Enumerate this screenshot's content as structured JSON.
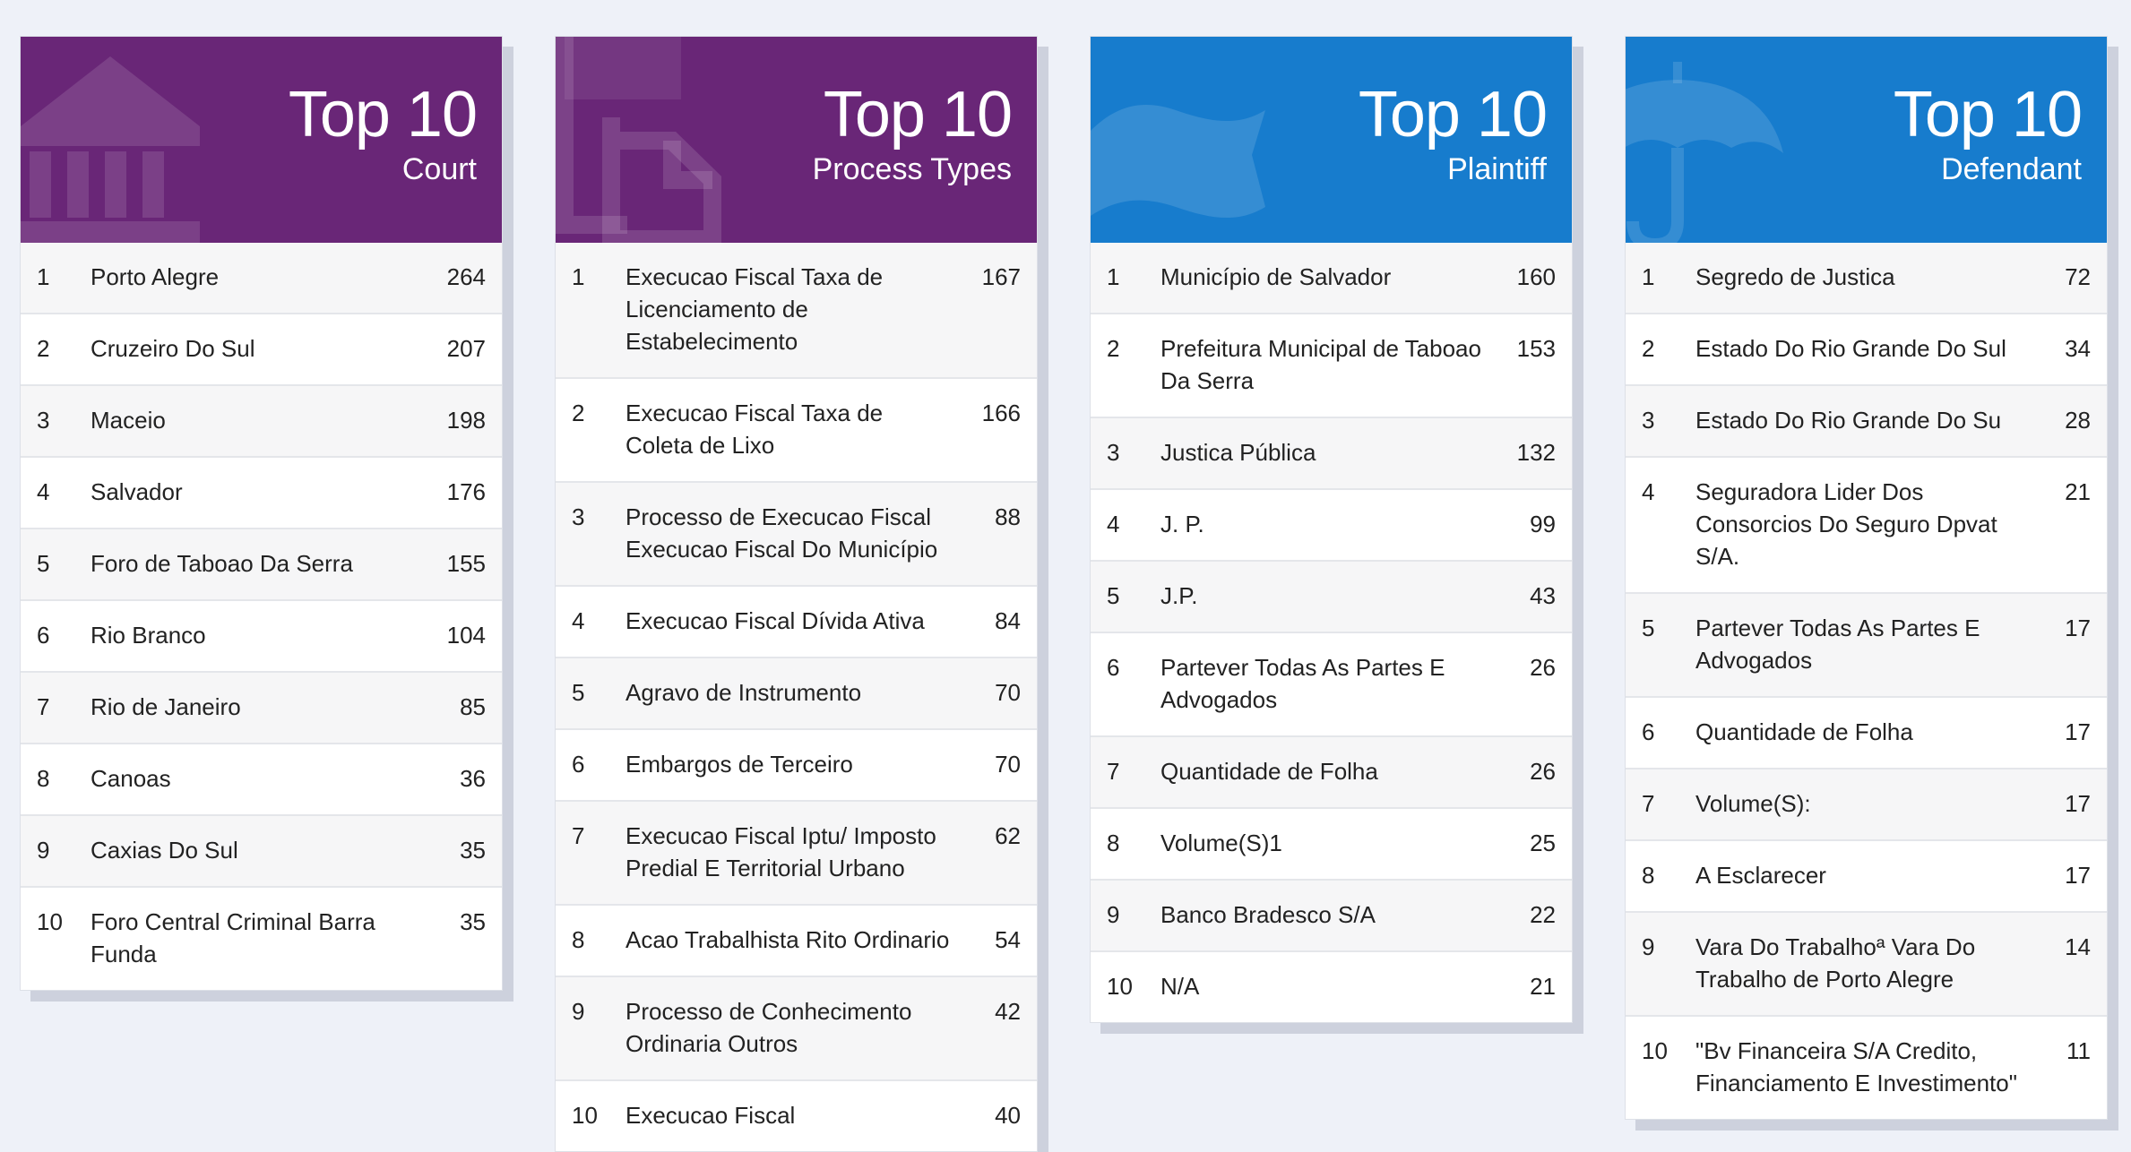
{
  "colors": {
    "purple": "#692677",
    "blue": "#177ccd",
    "background": "#eef1f8"
  },
  "cards": [
    {
      "title": "Top 10",
      "subtitle": "Court",
      "icon": "courthouse-icon",
      "rows": [
        {
          "rank": "1",
          "name": "Porto Alegre",
          "count": "264"
        },
        {
          "rank": "2",
          "name": "Cruzeiro Do Sul",
          "count": "207"
        },
        {
          "rank": "3",
          "name": "Maceio",
          "count": "198"
        },
        {
          "rank": "4",
          "name": "Salvador",
          "count": "176"
        },
        {
          "rank": "5",
          "name": "Foro de Taboao Da Serra",
          "count": "155"
        },
        {
          "rank": "6",
          "name": "Rio Branco",
          "count": "104"
        },
        {
          "rank": "7",
          "name": "Rio de Janeiro",
          "count": "85"
        },
        {
          "rank": "8",
          "name": "Canoas",
          "count": "36"
        },
        {
          "rank": "9",
          "name": "Caxias Do Sul",
          "count": "35"
        },
        {
          "rank": "10",
          "name": "Foro Central Criminal Barra Funda",
          "count": "35"
        }
      ]
    },
    {
      "title": "Top 10",
      "subtitle": "Process Types",
      "icon": "documents-icon",
      "rows": [
        {
          "rank": "1",
          "name": "Execucao Fiscal Taxa de Licenciamento de Estabelecimento",
          "count": "167"
        },
        {
          "rank": "2",
          "name": "Execucao Fiscal Taxa de Coleta de Lixo",
          "count": "166"
        },
        {
          "rank": "3",
          "name": "Processo de Execucao Fiscal Execucao Fiscal Do Município",
          "count": "88"
        },
        {
          "rank": "4",
          "name": "Execucao Fiscal Dívida Ativa",
          "count": "84"
        },
        {
          "rank": "5",
          "name": "Agravo de Instrumento",
          "count": "70"
        },
        {
          "rank": "6",
          "name": "Embargos de Terceiro",
          "count": "70"
        },
        {
          "rank": "7",
          "name": "Execucao Fiscal Iptu/ Imposto Predial E Territorial Urbano",
          "count": "62"
        },
        {
          "rank": "8",
          "name": "Acao Trabalhista Rito Ordinario",
          "count": "54"
        },
        {
          "rank": "9",
          "name": "Processo de Conhecimento Ordinaria Outros",
          "count": "42"
        },
        {
          "rank": "10",
          "name": "Execucao Fiscal",
          "count": "40"
        }
      ]
    },
    {
      "title": "Top 10",
      "subtitle": "Plaintiff",
      "icon": "flag-icon",
      "rows": [
        {
          "rank": "1",
          "name": "Município de Salvador",
          "count": "160"
        },
        {
          "rank": "2",
          "name": "Prefeitura Municipal de Taboao Da Serra",
          "count": "153"
        },
        {
          "rank": "3",
          "name": "Justica Pública",
          "count": "132"
        },
        {
          "rank": "4",
          "name": "J. P.",
          "count": "99"
        },
        {
          "rank": "5",
          "name": "J.P.",
          "count": "43"
        },
        {
          "rank": "6",
          "name": "Partever Todas As Partes E Advogados",
          "count": "26"
        },
        {
          "rank": "7",
          "name": "Quantidade de Folha",
          "count": "26"
        },
        {
          "rank": "8",
          "name": "Volume(S)1",
          "count": "25"
        },
        {
          "rank": "9",
          "name": "Banco Bradesco S/A",
          "count": "22"
        },
        {
          "rank": "10",
          "name": "N/A",
          "count": "21"
        }
      ]
    },
    {
      "title": "Top 10",
      "subtitle": "Defendant",
      "icon": "umbrella-icon",
      "rows": [
        {
          "rank": "1",
          "name": "Segredo de Justica",
          "count": "72"
        },
        {
          "rank": "2",
          "name": "Estado Do Rio Grande Do Sul",
          "count": "34"
        },
        {
          "rank": "3",
          "name": "Estado Do Rio Grande Do Su",
          "count": "28"
        },
        {
          "rank": "4",
          "name": "Seguradora Lider Dos Consorcios Do Seguro Dpvat S/A.",
          "count": "21"
        },
        {
          "rank": "5",
          "name": "Partever Todas As Partes E Advogados",
          "count": "17"
        },
        {
          "rank": "6",
          "name": "Quantidade de Folha",
          "count": "17"
        },
        {
          "rank": "7",
          "name": "Volume(S):",
          "count": "17"
        },
        {
          "rank": "8",
          "name": "A Esclarecer",
          "count": "17"
        },
        {
          "rank": "9",
          "name": "Vara Do Trabalhoª Vara Do Trabalho de Porto Alegre",
          "count": "14"
        },
        {
          "rank": "10",
          "name": "\"Bv Financeira S/A Credito, Financiamento E Investimento\"",
          "count": "11"
        }
      ]
    }
  ]
}
